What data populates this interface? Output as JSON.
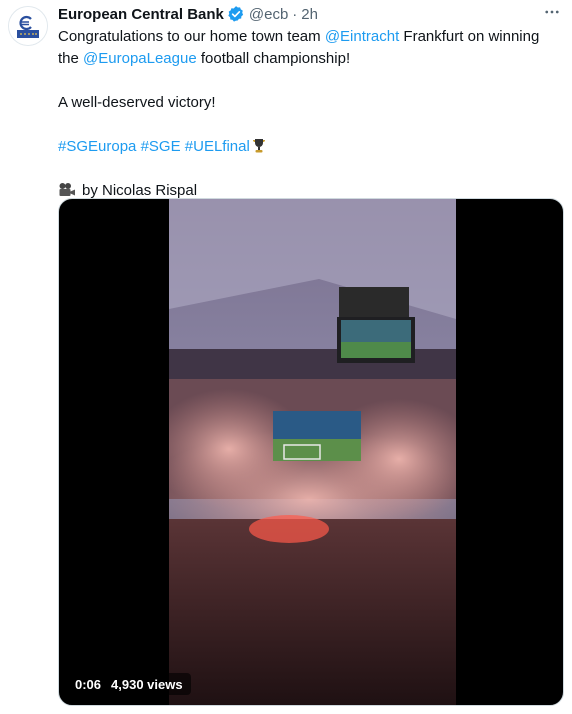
{
  "author": {
    "name": "European Central Bank",
    "handle": "@ecb",
    "separator": "·",
    "time": "2h"
  },
  "icons": {
    "avatar": "ecb-logo-icon",
    "verified": "verified-badge-icon",
    "more": "more-options-icon",
    "trophy": "trophy-emoji-icon",
    "camera": "video-camera-emoji-icon"
  },
  "tweet": {
    "line1_pre": "Congratulations to our home town team ",
    "mention1": "@Eintracht",
    "line1_post": " Frankfurt on winning",
    "line2_pre": "the ",
    "mention2": "@EuropaLeague",
    "line2_post": " football championship!",
    "line3": "A well-deserved victory!",
    "hashtags": [
      "#SGEuropa",
      "#SGE",
      "#UELfinal"
    ],
    "credit": "by Nicolas Rispal"
  },
  "video": {
    "timestamp": "0:06",
    "views": "4,930 views"
  },
  "colors": {
    "link": "#1d9bf0",
    "text": "#0f1419",
    "secondary": "#536471",
    "verified": "#1d9bf0"
  }
}
